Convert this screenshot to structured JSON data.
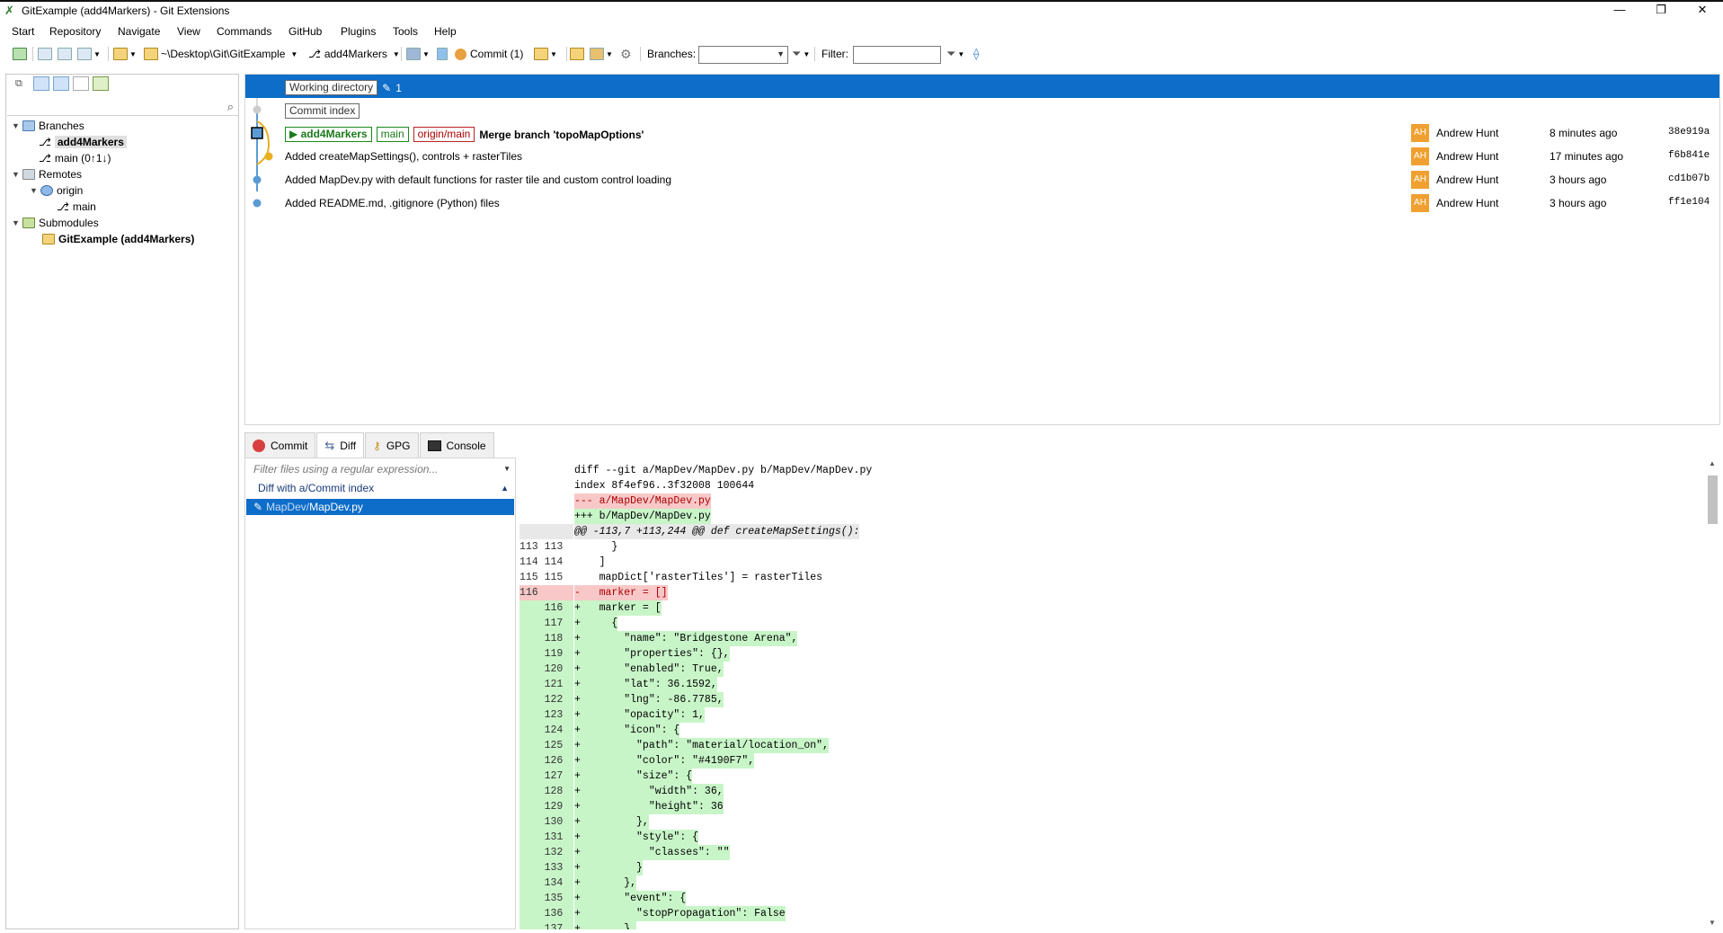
{
  "window": {
    "title": "GitExample (add4Markers) - Git Extensions",
    "controls": {
      "minimize": "—",
      "restore": "❐",
      "close": "✕"
    }
  },
  "menu": [
    "Start",
    "Repository",
    "Navigate",
    "View",
    "Commands",
    "GitHub",
    "Plugins",
    "Tools",
    "Help"
  ],
  "toolbar": {
    "repo_path": "~\\Desktop\\Git\\GitExample",
    "branch": "add4Markers",
    "commit_label": "Commit (1)",
    "branches_label": "Branches:",
    "branches_value": "",
    "filter_label": "Filter:",
    "filter_value": ""
  },
  "left_panel": {
    "search_placeholder": "",
    "tree": {
      "branches_label": "Branches",
      "branch_current": "add4Markers",
      "branch_main": "main (0↑1↓)",
      "remotes_label": "Remotes",
      "remote_origin": "origin",
      "remote_main": "main",
      "submodules_label": "Submodules",
      "submodule": "GitExample (add4Markers)"
    }
  },
  "revisions": {
    "working_dir": "Working directory",
    "working_count": "1",
    "commit_index": "Commit index",
    "commits": [
      {
        "badges": [
          "add4Markers",
          "main",
          "origin/main"
        ],
        "message": "Merge branch 'topoMapOptions'",
        "initials": "AH",
        "author": "Andrew Hunt",
        "date": "8 minutes ago",
        "hash": "38e919a"
      },
      {
        "message": "Added createMapSettings(), controls + rasterTiles",
        "initials": "AH",
        "author": "Andrew Hunt",
        "date": "17 minutes ago",
        "hash": "f6b841e"
      },
      {
        "message": "Added MapDev.py with default functions for raster tile and custom control loading",
        "initials": "AH",
        "author": "Andrew Hunt",
        "date": "3 hours ago",
        "hash": "cd1b07b"
      },
      {
        "message": "Added README.md, .gitignore (Python) files",
        "initials": "AH",
        "author": "Andrew Hunt",
        "date": "3 hours ago",
        "hash": "ff1e104"
      }
    ]
  },
  "tabs": [
    "Commit",
    "Diff",
    "GPG",
    "Console"
  ],
  "diff": {
    "filter_placeholder": "Filter files using a regular expression...",
    "group_label": "Diff with a/Commit index",
    "file_dir": "MapDev/",
    "file_name": "MapDev.py",
    "lines": [
      {
        "g": "",
        "t": "diff --git a/MapDev/MapDev.py b/MapDev/MapDev.py",
        "k": "h"
      },
      {
        "g": "",
        "t": "index 8f4ef96..3f32008 100644",
        "k": "h"
      },
      {
        "g": "",
        "t": "--- a/MapDev/MapDev.py",
        "k": "rm"
      },
      {
        "g": "",
        "t": "+++ b/MapDev/MapDev.py",
        "k": "ad"
      },
      {
        "g": "",
        "t": "@@ -113,7 +113,244 @@ def createMapSettings():",
        "k": "hunk"
      },
      {
        "g": "113 113",
        "t": "      }",
        "k": "c"
      },
      {
        "g": "114 114",
        "t": "    ]",
        "k": "c"
      },
      {
        "g": "115 115",
        "t": "    mapDict['rasterTiles'] = rasterTiles",
        "k": "c"
      },
      {
        "g": "116",
        "t": "-   marker = []",
        "k": "rm"
      },
      {
        "g": "    116",
        "t": "+   marker = [",
        "k": "ad"
      },
      {
        "g": "    117",
        "t": "+     {",
        "k": "ad"
      },
      {
        "g": "    118",
        "t": "+       \"name\": \"Bridgestone Arena\",",
        "k": "ad"
      },
      {
        "g": "    119",
        "t": "+       \"properties\": {},",
        "k": "ad"
      },
      {
        "g": "    120",
        "t": "+       \"enabled\": True,",
        "k": "ad"
      },
      {
        "g": "    121",
        "t": "+       \"lat\": 36.1592,",
        "k": "ad"
      },
      {
        "g": "    122",
        "t": "+       \"lng\": -86.7785,",
        "k": "ad"
      },
      {
        "g": "    123",
        "t": "+       \"opacity\": 1,",
        "k": "ad"
      },
      {
        "g": "    124",
        "t": "+       \"icon\": {",
        "k": "ad"
      },
      {
        "g": "    125",
        "t": "+         \"path\": \"material/location_on\",",
        "k": "ad"
      },
      {
        "g": "    126",
        "t": "+         \"color\": \"#4190F7\",",
        "k": "ad"
      },
      {
        "g": "    127",
        "t": "+         \"size\": {",
        "k": "ad"
      },
      {
        "g": "    128",
        "t": "+           \"width\": 36,",
        "k": "ad"
      },
      {
        "g": "    129",
        "t": "+           \"height\": 36",
        "k": "ad"
      },
      {
        "g": "    130",
        "t": "+         },",
        "k": "ad"
      },
      {
        "g": "    131",
        "t": "+         \"style\": {",
        "k": "ad"
      },
      {
        "g": "    132",
        "t": "+           \"classes\": \"\"",
        "k": "ad"
      },
      {
        "g": "    133",
        "t": "+         }",
        "k": "ad"
      },
      {
        "g": "    134",
        "t": "+       },",
        "k": "ad"
      },
      {
        "g": "    135",
        "t": "+       \"event\": {",
        "k": "ad"
      },
      {
        "g": "    136",
        "t": "+         \"stopPropagation\": False",
        "k": "ad"
      },
      {
        "g": "    137",
        "t": "+       },",
        "k": "ad"
      }
    ]
  },
  "colors": {
    "selection": "#0d6dc8",
    "added_bg": "#c8f5c8",
    "removed_bg": "#f8c8c8",
    "avatar": "#f0a030",
    "graph_blue": "#5b9bd5",
    "graph_yellow": "#e8b020"
  }
}
